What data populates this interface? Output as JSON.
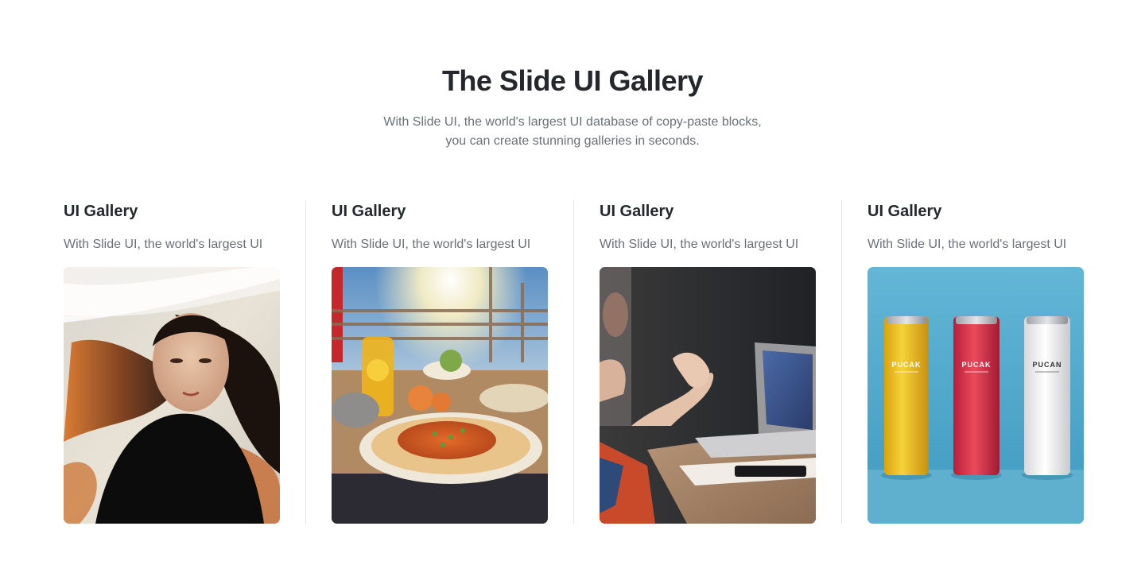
{
  "header": {
    "title": "The Slide UI Gallery",
    "subtitle_line1": "With Slide UI, the world's largest UI database of copy-paste blocks,",
    "subtitle_line2": "you can create stunning galleries in seconds."
  },
  "cards": [
    {
      "title": "UI Gallery",
      "description": "With Slide UI, the world's largest UI",
      "image": "portrait-woman-flowing-hair"
    },
    {
      "title": "UI Gallery",
      "description": "With Slide UI, the world's largest UI",
      "image": "food-curry-plate-outdoor"
    },
    {
      "title": "UI Gallery",
      "description": "With Slide UI, the world's largest UI",
      "image": "hands-gesturing-laptop-meeting"
    },
    {
      "title": "UI Gallery",
      "description": "With Slide UI, the world's largest UI",
      "image": "three-cans-product-shot",
      "can_labels": [
        "PUCAK",
        "PUCAK",
        "PUCAN"
      ]
    }
  ],
  "colors": {
    "title": "#24272c",
    "text_muted": "#6b7078",
    "divider": "#e6e8eb"
  }
}
